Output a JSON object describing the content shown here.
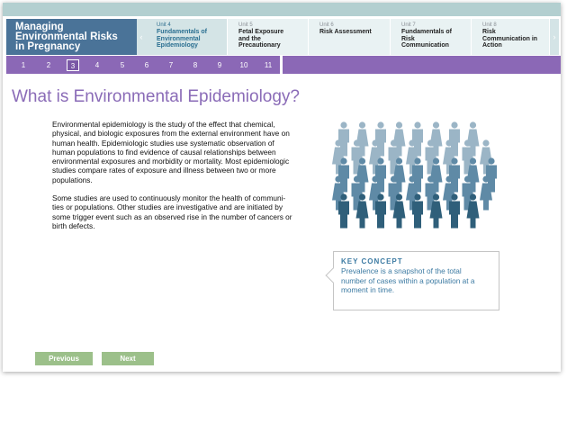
{
  "course": {
    "title_lines": [
      "Managing",
      "Environmental Risks",
      "in Pregnancy"
    ]
  },
  "units": [
    {
      "number": "Unit 4",
      "name_lines": [
        "Fundamentals of",
        "Environmental",
        "Epidemiology"
      ],
      "active": true
    },
    {
      "number": "Unit 5",
      "name_lines": [
        "Fetal Exposure",
        "and the",
        "Precautionary"
      ],
      "active": false
    },
    {
      "number": "Unit 6",
      "name_lines": [
        "Risk Assessment"
      ],
      "active": false
    },
    {
      "number": "Unit 7",
      "name_lines": [
        "Fundamentals of",
        "Risk",
        "Communication"
      ],
      "active": false
    },
    {
      "number": "Unit 8",
      "name_lines": [
        "Risk",
        "Communication in",
        "Action"
      ],
      "active": false
    }
  ],
  "unit_nav": {
    "prev_glyph": "‹",
    "next_glyph": "›"
  },
  "pages": [
    "1",
    "2",
    "3",
    "4",
    "5",
    "6",
    "7",
    "8",
    "9",
    "10",
    "11"
  ],
  "current_page": "3",
  "content": {
    "title": "What is Environmental Epidemiology?",
    "paragraph_1_lines": [
      "Environmental epidemiology is the study of the effect that chemical,",
      "physical, and biologic exposures from the external environment have on",
      "human health. Epidemiologic studies use systematic observation of",
      "human populations to find evidence of causal relationships between",
      "environmental exposures and morbidity or mortality. Most epidemiologic",
      "studies compare rates of exposure and illness between two or more",
      "populations."
    ],
    "paragraph_2_lines": [
      "Some studies are used to continuously monitor the health of communi-",
      "ties or populations. Other studies are investigative and are initiated by",
      "some trigger event such as an observed rise in the number of cancers or",
      "birth defects."
    ]
  },
  "key_concept": {
    "heading": "KEY CONCEPT",
    "text_lines": [
      "Prevalence is a snapshot of the total",
      "number of cases within a population at a",
      "moment in time."
    ]
  },
  "buttons": {
    "previous": "Previous",
    "next": "Next"
  },
  "colors": {
    "title_block": "#4a7398",
    "page_bar": "#8b68b6",
    "title_text": "#8a6bb7",
    "concept_text": "#3d7ba3",
    "button": "#9cc08a",
    "people_light": "#9bb5c6",
    "people_mid": "#5f8aa6",
    "people_dark": "#2f5f7a"
  }
}
